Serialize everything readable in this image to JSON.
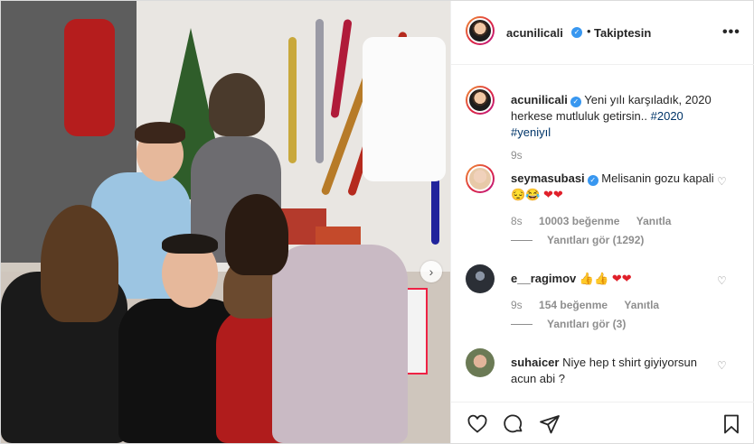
{
  "header": {
    "username": "acunilicali",
    "separator": "•",
    "follow_state": "Takiptesin",
    "more_icon": "more-icon"
  },
  "caption": {
    "username": "acunilicali",
    "text": "Yeni yılı karşıladık, 2020 herkese mutluluk getirsin..",
    "hashtag1": "#2020",
    "hashtag2": "#yeniyıl",
    "time": "9s"
  },
  "comments": [
    {
      "username": "seymasubasi",
      "text": "Melisanin gozu kapali",
      "emoji_faces": "😔😂",
      "emoji_hearts": "❤❤",
      "time": "8s",
      "likes": "10003 beğenme",
      "reply": "Yanıtla",
      "view_replies": "Yanıtları gör (1292)"
    },
    {
      "username": "e__ragimov",
      "emoji_thumbs": "👍👍",
      "emoji_hearts": "❤❤",
      "time": "9s",
      "likes": "154 beğenme",
      "reply": "Yanıtla",
      "view_replies": "Yanıtları gör (3)"
    },
    {
      "username": "suhaicer",
      "text": "Niye hep t shirt giyiyorsun acun abi ?"
    }
  ],
  "colors": {
    "verified": "#3897f0",
    "hashtag": "#003569",
    "muted": "#8e8e8e",
    "heart": "#e0202a"
  }
}
